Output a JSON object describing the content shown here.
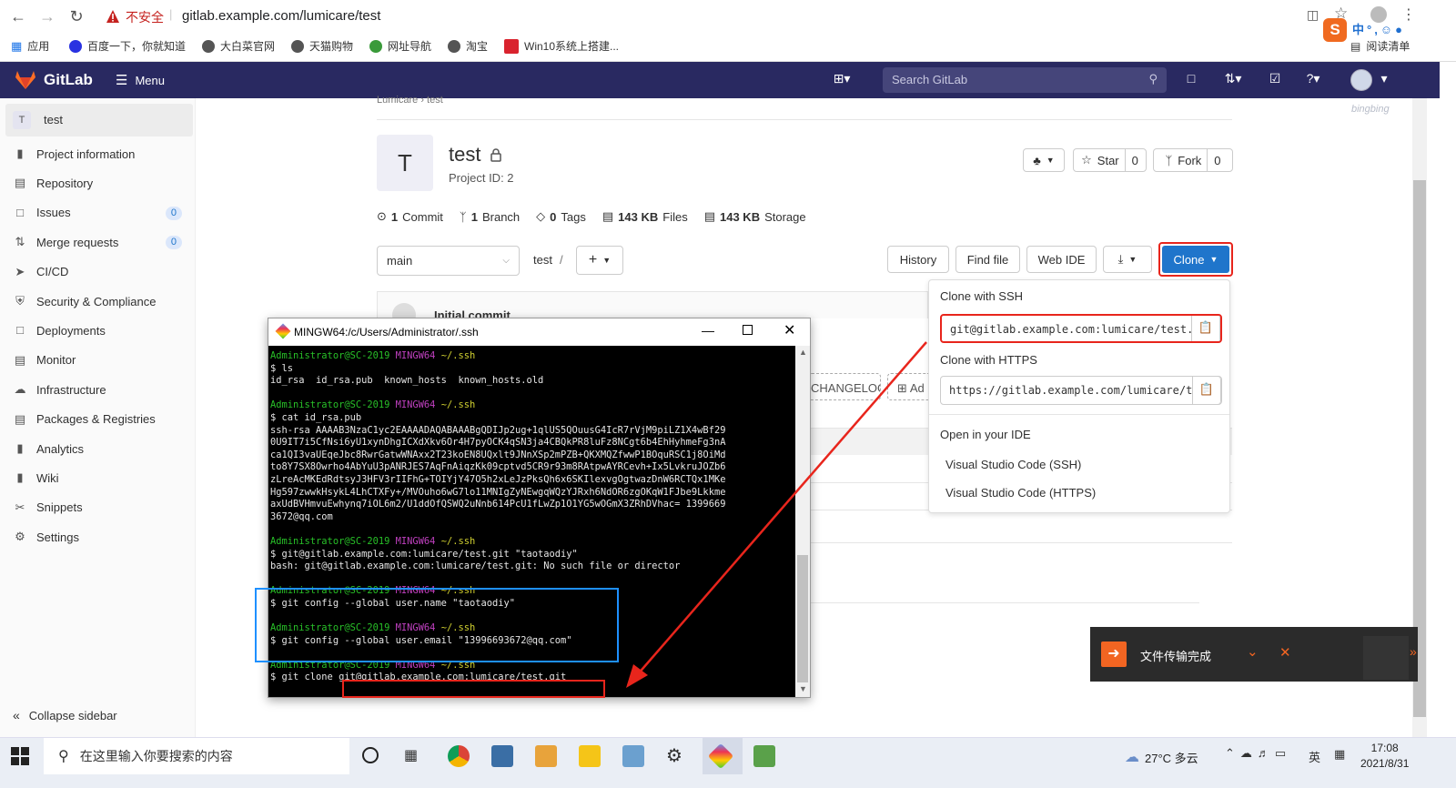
{
  "browser": {
    "insecure_label": "不安全",
    "url": "gitlab.example.com/lumicare/test",
    "bookmarks": [
      "应用",
      "百度一下，你就知道",
      "大白菜官网",
      "天猫购物",
      "网址导航",
      "淘宝",
      "Win10系统上搭建..."
    ],
    "reading_list": "阅读清单"
  },
  "header": {
    "brand": "GitLab",
    "menu": "Menu",
    "search_placeholder": "Search GitLab",
    "user_watermark": "bingbing"
  },
  "sidebar": {
    "project_initial": "T",
    "project_name": "test",
    "items": [
      {
        "label": "Project information",
        "icon": "info-icon"
      },
      {
        "label": "Repository",
        "icon": "book-icon"
      },
      {
        "label": "Issues",
        "icon": "issues-icon",
        "count": "0"
      },
      {
        "label": "Merge requests",
        "icon": "merge-icon",
        "count": "0"
      },
      {
        "label": "CI/CD",
        "icon": "rocket-icon"
      },
      {
        "label": "Security & Compliance",
        "icon": "shield-icon"
      },
      {
        "label": "Deployments",
        "icon": "deploy-icon"
      },
      {
        "label": "Monitor",
        "icon": "monitor-icon"
      },
      {
        "label": "Infrastructure",
        "icon": "cloud-icon"
      },
      {
        "label": "Packages & Registries",
        "icon": "package-icon"
      },
      {
        "label": "Analytics",
        "icon": "chart-icon"
      },
      {
        "label": "Wiki",
        "icon": "wiki-icon"
      },
      {
        "label": "Snippets",
        "icon": "scissors-icon"
      },
      {
        "label": "Settings",
        "icon": "gear-icon"
      }
    ],
    "collapse": "Collapse sidebar"
  },
  "project": {
    "breadcrumb": [
      "Lumicare",
      "test"
    ],
    "initial": "T",
    "name": "test",
    "project_id": "Project ID: 2",
    "star": "Star",
    "star_count": "0",
    "fork": "Fork",
    "fork_count": "0",
    "stats": [
      {
        "value": "1",
        "label": "Commit"
      },
      {
        "value": "1",
        "label": "Branch"
      },
      {
        "value": "0",
        "label": "Tags"
      },
      {
        "value": "143 KB",
        "label": "Files"
      },
      {
        "value": "143 KB",
        "label": "Storage"
      }
    ],
    "branch": "main",
    "path": "test",
    "path_sep": "/",
    "buttons": {
      "history": "History",
      "find_file": "Find file",
      "web_ide": "Web IDE",
      "clone": "Clone"
    },
    "commit_title": "Initial commit",
    "changelog": "CHANGELOG",
    "add_partial": "Ad"
  },
  "clone": {
    "ssh_label": "Clone with SSH",
    "ssh_url": "git@gitlab.example.com:lumicare/test.git",
    "https_label": "Clone with HTTPS",
    "https_url": "https://gitlab.example.com/lumicare/test.git",
    "ide_label": "Open in your IDE",
    "ide_ssh": "Visual Studio Code (SSH)",
    "ide_https": "Visual Studio Code (HTTPS)"
  },
  "terminal": {
    "title": "MINGW64:/c/Users/Administrator/.ssh",
    "lines": [
      {
        "t": "prompt",
        "user": "Administrator@SC-2019",
        "sys": "MINGW64",
        "dir": "~/.ssh"
      },
      {
        "t": "out",
        "text": "$ ls"
      },
      {
        "t": "out",
        "text": "id_rsa  id_rsa.pub  known_hosts  known_hosts.old"
      },
      {
        "t": "blank"
      },
      {
        "t": "prompt",
        "user": "Administrator@SC-2019",
        "sys": "MINGW64",
        "dir": "~/.ssh"
      },
      {
        "t": "out",
        "text": "$ cat id_rsa.pub"
      },
      {
        "t": "out",
        "text": "ssh-rsa AAAAB3NzaC1yc2EAAAADAQABAAABgQDIJp2ug+1qlUS5QOuusG4IcR7rVjM9piLZ1X4wBf29"
      },
      {
        "t": "out",
        "text": "0U9IT7i5CfNsi6yU1xynDhgICXdXkv6Or4H7pyOCK4qSN3ja4CBQkPR8luFz8NCgt6b4EhHyhmeFg3nA"
      },
      {
        "t": "out",
        "text": "ca1QI3vaUEqeJbc8RwrGatwWNAxx2T23koEN8UQxlt9JNnXSp2mPZB+QKXMQZfwwP1BOquRSC1j8OiMd"
      },
      {
        "t": "out",
        "text": "to8Y7SX8Owrho4AbYuU3pANRJES7AqFnAiqzKk09cptvd5CR9r93m8RAtpwAYRCevh+Ix5LvkruJOZb6"
      },
      {
        "t": "out",
        "text": "zLreAcMKEdRdtsyJ3HFV3rIIFhG+TOIYjY47O5h2xLeJzPksQh6x6SKIlexvgOgtwazDnW6RCTQx1MKe"
      },
      {
        "t": "out",
        "text": "Hg597zwwkHsykL4LhCTXFy+/MVOuho6wG7lo11MNIgZyNEwgqWQzYJRxh6NdOR6zgOKqW1FJbe9Lkkme"
      },
      {
        "t": "out",
        "text": "axUdBVHmvuEwhynq7iOL6m2/U1ddOfQSWQ2uNnb614PcU1fLwZp1O1YG5wOGmX3ZRhDVhac= 1399669"
      },
      {
        "t": "out",
        "text": "3672@qq.com"
      },
      {
        "t": "blank"
      },
      {
        "t": "prompt",
        "user": "Administrator@SC-2019",
        "sys": "MINGW64",
        "dir": "~/.ssh"
      },
      {
        "t": "out",
        "text": "$ git@gitlab.example.com:lumicare/test.git \"taotaodiy\""
      },
      {
        "t": "out",
        "text": "bash: git@gitlab.example.com:lumicare/test.git: No such file or director"
      },
      {
        "t": "blank"
      },
      {
        "t": "prompt",
        "user": "Administrator@SC-2019",
        "sys": "MINGW64",
        "dir": "~/.ssh"
      },
      {
        "t": "out",
        "text": "$ git config --global user.name \"taotaodiy\""
      },
      {
        "t": "blank"
      },
      {
        "t": "prompt",
        "user": "Administrator@SC-2019",
        "sys": "MINGW64",
        "dir": "~/.ssh"
      },
      {
        "t": "out",
        "text": "$ git config --global user.email \"13996693672@qq.com\""
      },
      {
        "t": "blank"
      },
      {
        "t": "prompt",
        "user": "Administrator@SC-2019",
        "sys": "MINGW64",
        "dir": "~/.ssh"
      },
      {
        "t": "out",
        "text": "$ git clone git@gitlab.example.com:lumicare/test.git"
      }
    ]
  },
  "notification": {
    "text": "文件传输完成"
  },
  "taskbar": {
    "search_placeholder": "在这里输入你要搜索的内容",
    "weather": "27°C 多云",
    "ime": "英",
    "time": "17:08",
    "date": "2021/8/31"
  },
  "colors": {
    "gitlab_header": "#292961",
    "clone_blue": "#1f75cb",
    "annotation_red": "#e8251c",
    "annotation_blue": "#1e90ff"
  }
}
